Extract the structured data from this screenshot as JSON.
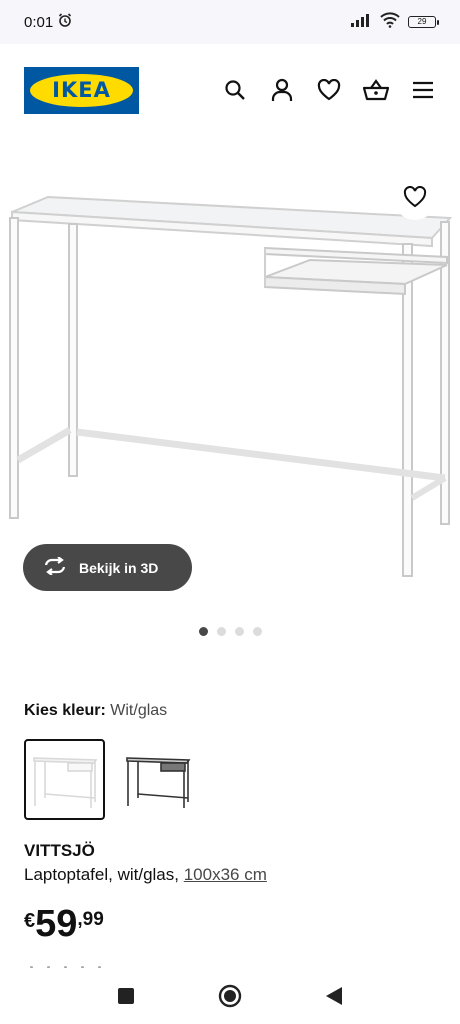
{
  "status": {
    "time": "0:01",
    "battery": "29"
  },
  "brand": {
    "logo_text": "IKEA",
    "blue": "#0058a3",
    "yellow": "#ffdb00"
  },
  "header_icons": [
    "search-icon",
    "user-icon",
    "heart-icon",
    "basket-icon",
    "menu-icon"
  ],
  "gallery": {
    "view_3d_label": "Bekijk in 3D",
    "dot_count": 4,
    "active_dot": 0
  },
  "colour": {
    "label": "Kies kleur:",
    "value": "Wit/glas",
    "options": [
      "white",
      "black"
    ],
    "selected_index": 0
  },
  "product": {
    "name": "VITTSJÖ",
    "description": "Laptoptafel, wit/glas,",
    "dimensions": "100x36 cm",
    "price_currency": "€",
    "price_integer": "59",
    "price_decimal": ",99"
  },
  "nav": [
    "recent-apps-icon",
    "home-icon",
    "back-icon"
  ],
  "colors": {
    "accent": "#0058a3",
    "button_dark": "#484848"
  }
}
